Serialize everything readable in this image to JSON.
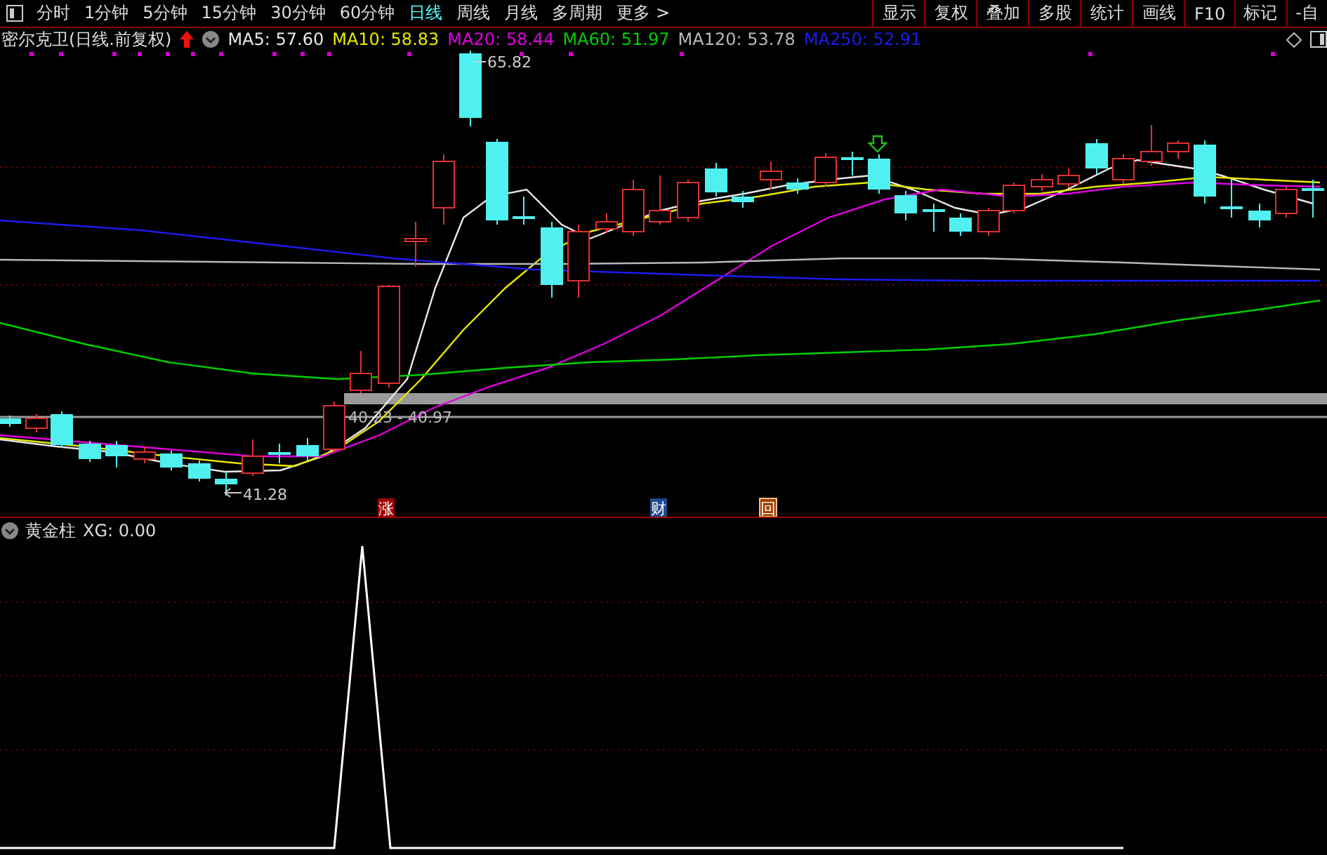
{
  "toolbar": {
    "tabs": [
      {
        "label": "分时",
        "selected": false
      },
      {
        "label": "1分钟",
        "selected": false
      },
      {
        "label": "5分钟",
        "selected": false
      },
      {
        "label": "15分钟",
        "selected": false
      },
      {
        "label": "30分钟",
        "selected": false
      },
      {
        "label": "60分钟",
        "selected": false
      },
      {
        "label": "日线",
        "selected": true
      },
      {
        "label": "周线",
        "selected": false
      },
      {
        "label": "月线",
        "selected": false
      },
      {
        "label": "多周期",
        "selected": false
      },
      {
        "label": "更多 >",
        "selected": false
      }
    ],
    "tools": [
      "显示",
      "复权",
      "叠加",
      "多股",
      "统计",
      "画线",
      "F10",
      "标记",
      "-自"
    ]
  },
  "legend": {
    "title": "密尔克卫(日线.前复权)",
    "moving_averages": [
      {
        "label": "MA5: 57.60",
        "color": "#e8e8e8"
      },
      {
        "label": "MA10: 58.83",
        "color": "#e8e800"
      },
      {
        "label": "MA20: 58.44",
        "color": "#e000e0"
      },
      {
        "label": "MA60: 51.97",
        "color": "#00d000"
      },
      {
        "label": "MA120: 53.78",
        "color": "#b8b8b8"
      },
      {
        "label": "MA250: 52.91",
        "color": "#1c1cf0"
      }
    ]
  },
  "chart": {
    "high_label": "65.82",
    "low_label": "41.28",
    "range_label": "40.23 - 40.97",
    "event_markers": [
      {
        "text": "涨",
        "kind": "rise"
      },
      {
        "text": "财",
        "kind": "finance"
      },
      {
        "text": "回",
        "kind": "buyback"
      }
    ]
  },
  "indicator": {
    "name": "黄金柱",
    "reading": "XG: 0.00"
  }
}
